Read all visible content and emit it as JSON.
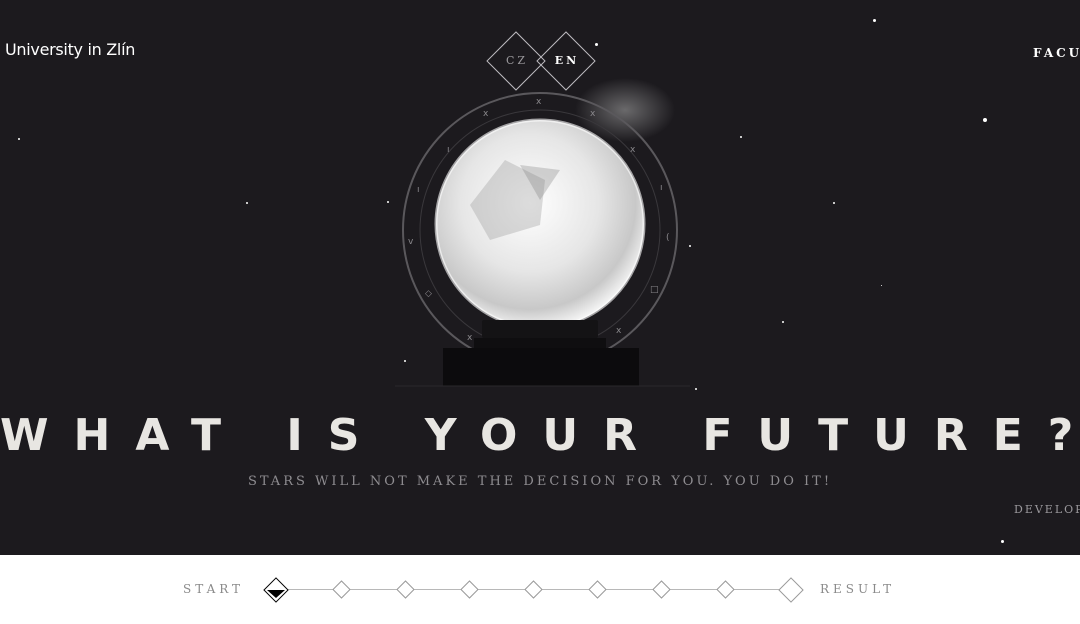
{
  "header": {
    "brand": "University in Zlín",
    "nav_right": "FACU",
    "languages": [
      {
        "label": "CZ",
        "active": false
      },
      {
        "label": "EN",
        "active": true
      }
    ]
  },
  "hero": {
    "title": "WHAT IS YOUR FUTURE?",
    "subtitle": "STARS WILL NOT MAKE THE DECISION FOR YOU. YOU DO IT!",
    "side_link": "DEVELOP"
  },
  "progress": {
    "start_label": "START",
    "result_label": "RESULT",
    "total_steps": 9,
    "current_step": 1
  },
  "colors": {
    "background": "#1c1a1e",
    "title": "#e8e6e2",
    "subtitle": "#8e8c90",
    "progress_bg": "#ffffff"
  }
}
